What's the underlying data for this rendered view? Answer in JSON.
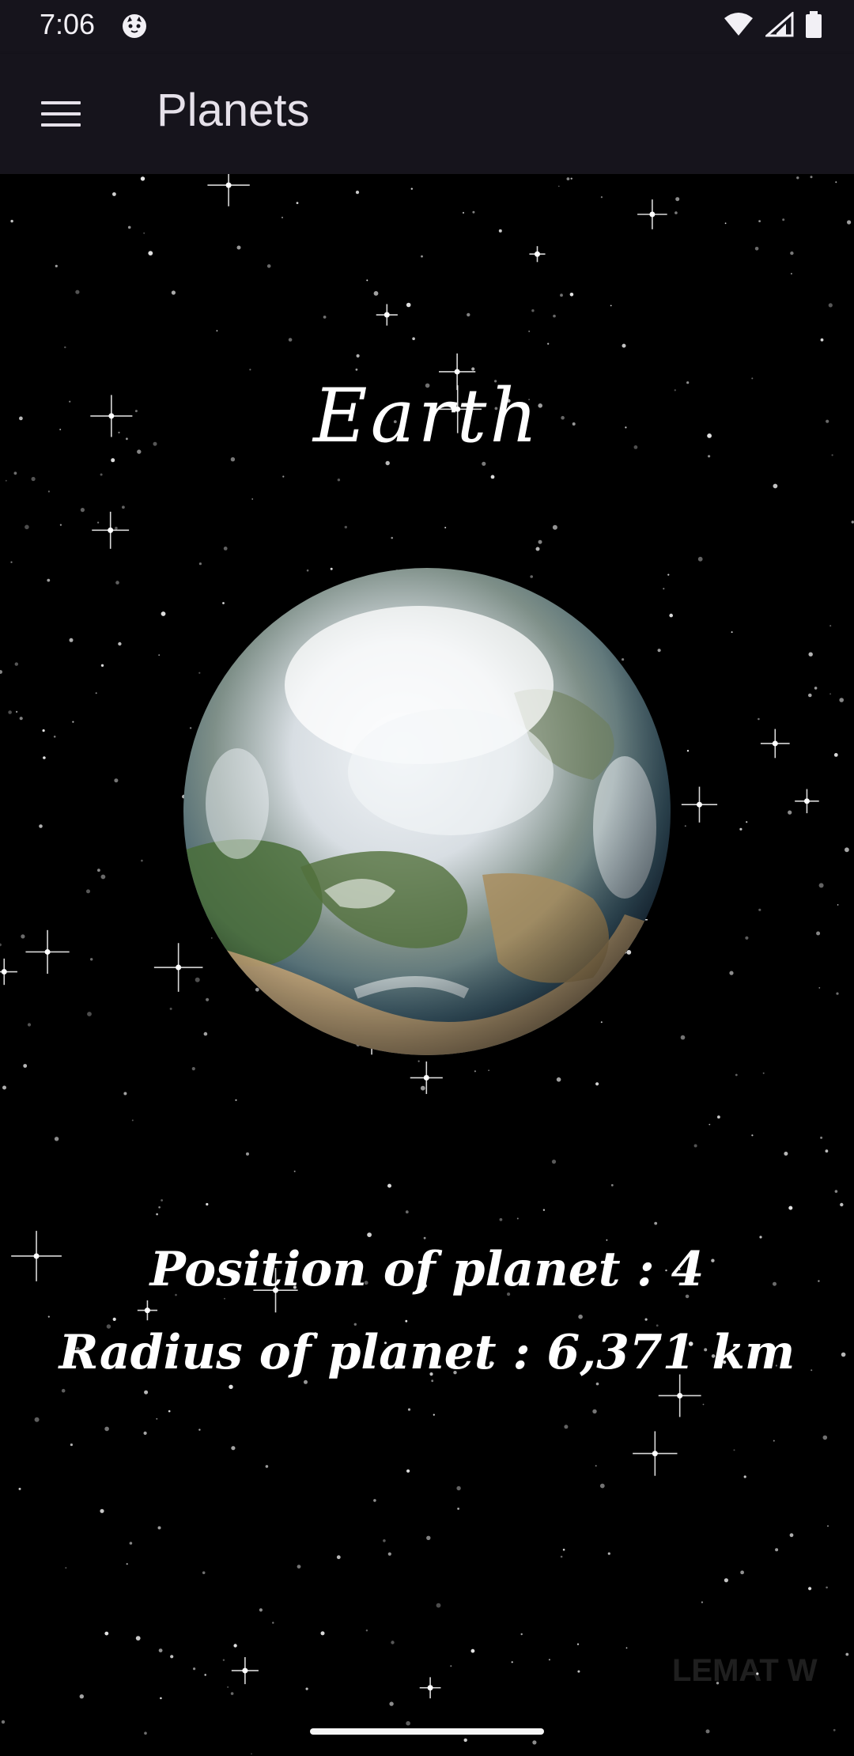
{
  "status_bar": {
    "time": "7:06",
    "icons": [
      "cat-notification-icon",
      "wifi-icon",
      "signal-icon",
      "battery-icon"
    ]
  },
  "app_bar": {
    "title": "Planets",
    "menu_icon": "hamburger-menu-icon"
  },
  "planet": {
    "name": "Earth",
    "position_text": "Position of planet : 4",
    "radius_text": "Radius of planet : 6,371 km"
  },
  "watermark": "LEMAT W",
  "colors": {
    "app_bar_bg": "#16141c",
    "background": "#000000",
    "text": "#ffffff"
  }
}
